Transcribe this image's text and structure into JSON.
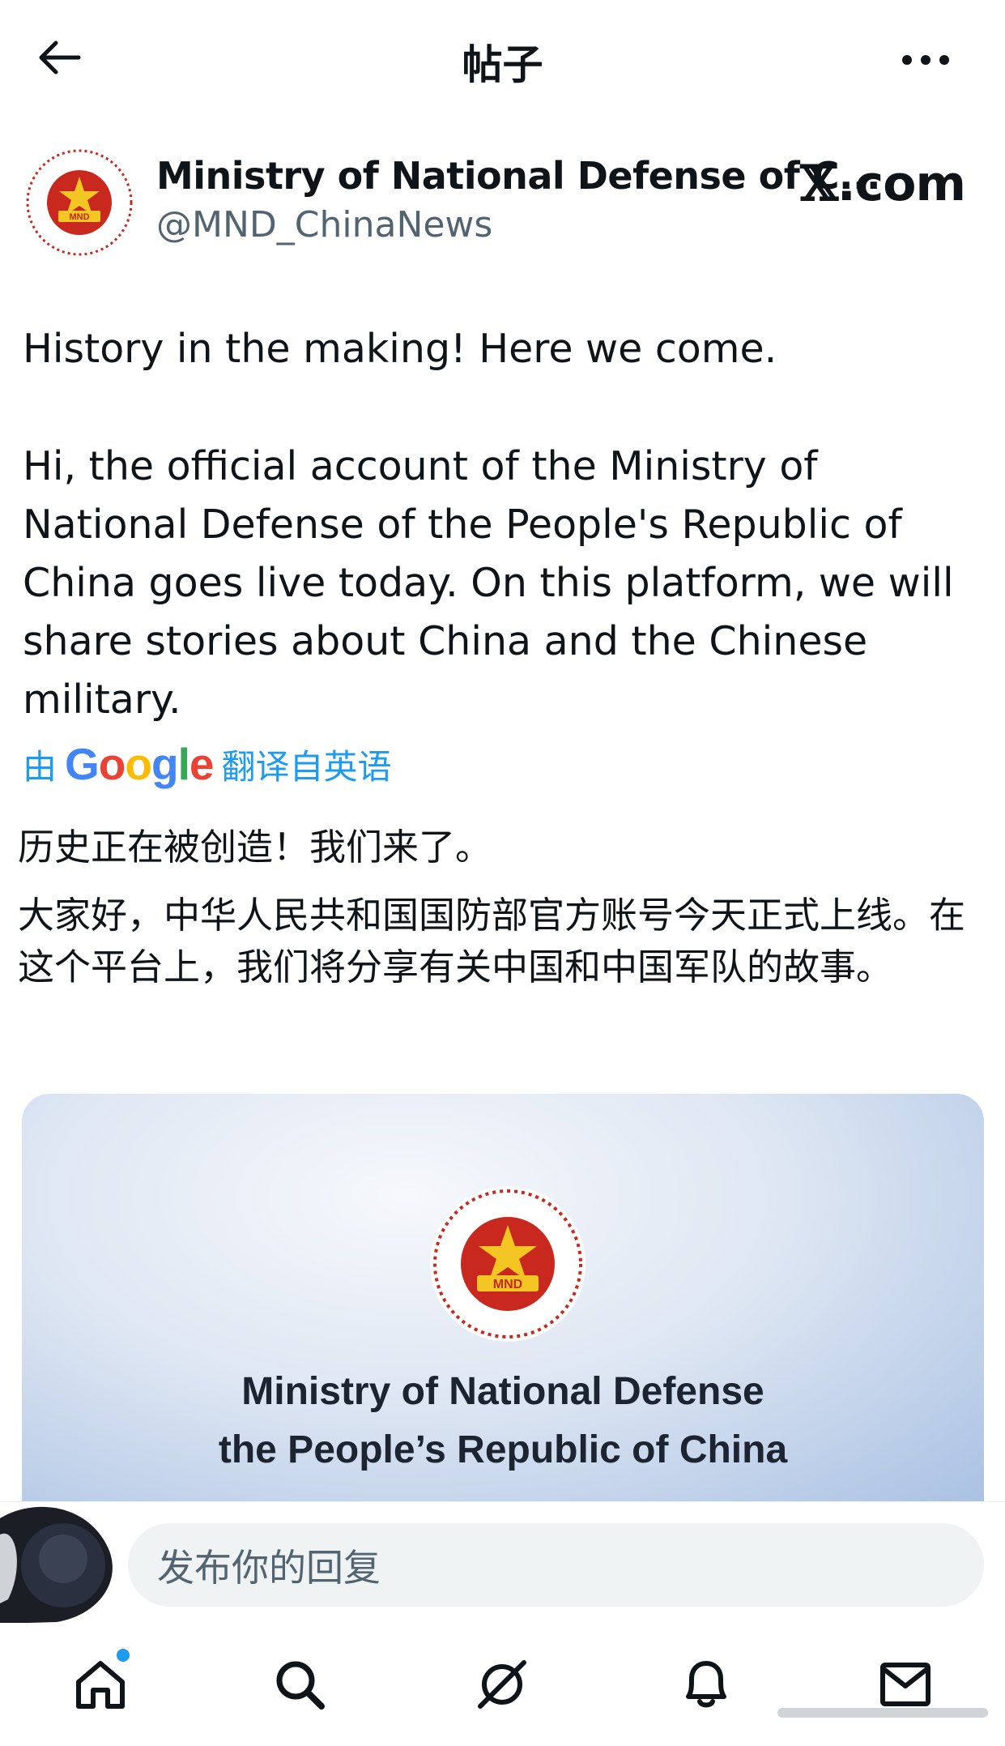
{
  "topbar": {
    "title": "帖子",
    "back_icon": "arrow-left-icon",
    "more_icon": "more-horizontal-icon"
  },
  "author": {
    "name": "Ministry of National Defense of C...",
    "handle": "@MND_ChinaNews",
    "avatar_text": "MND",
    "watermark_x": "𝕏",
    "watermark_domain": ".com"
  },
  "post": {
    "paragraph_1": "History in the making! Here we come.",
    "paragraph_2": "Hi, the official account of the Ministry of National Defense of the People's Republic of China goes live today. On this platform, we will share stories about China and the Chinese military."
  },
  "translation": {
    "prefix": "由",
    "google_letters": [
      "G",
      "o",
      "o",
      "g",
      "l",
      "e"
    ],
    "suffix": "翻译自英语",
    "paragraph_1": "历史正在被创造！我们来了。",
    "paragraph_2": "大家好，中华人民共和国国防部官方账号今天正式上线。在这个平台上，我们将分享有关中国和中国军队的故事。"
  },
  "media": {
    "emblem_text": "MND",
    "line_1": "Ministry of National Defense",
    "line_2": "the People’s Republic of China"
  },
  "reply": {
    "placeholder": "发布你的回复"
  },
  "nav": {
    "items": [
      {
        "icon": "home-icon",
        "has_dot": true
      },
      {
        "icon": "search-icon"
      },
      {
        "icon": "grok-icon"
      },
      {
        "icon": "notifications-bell-icon"
      },
      {
        "icon": "messages-envelope-icon"
      }
    ]
  },
  "colors": {
    "accent": "#1d9bf0",
    "text": "#0f1419",
    "secondary": "#536471",
    "emblem_red": "#c8281e",
    "emblem_gold": "#f3c623"
  }
}
